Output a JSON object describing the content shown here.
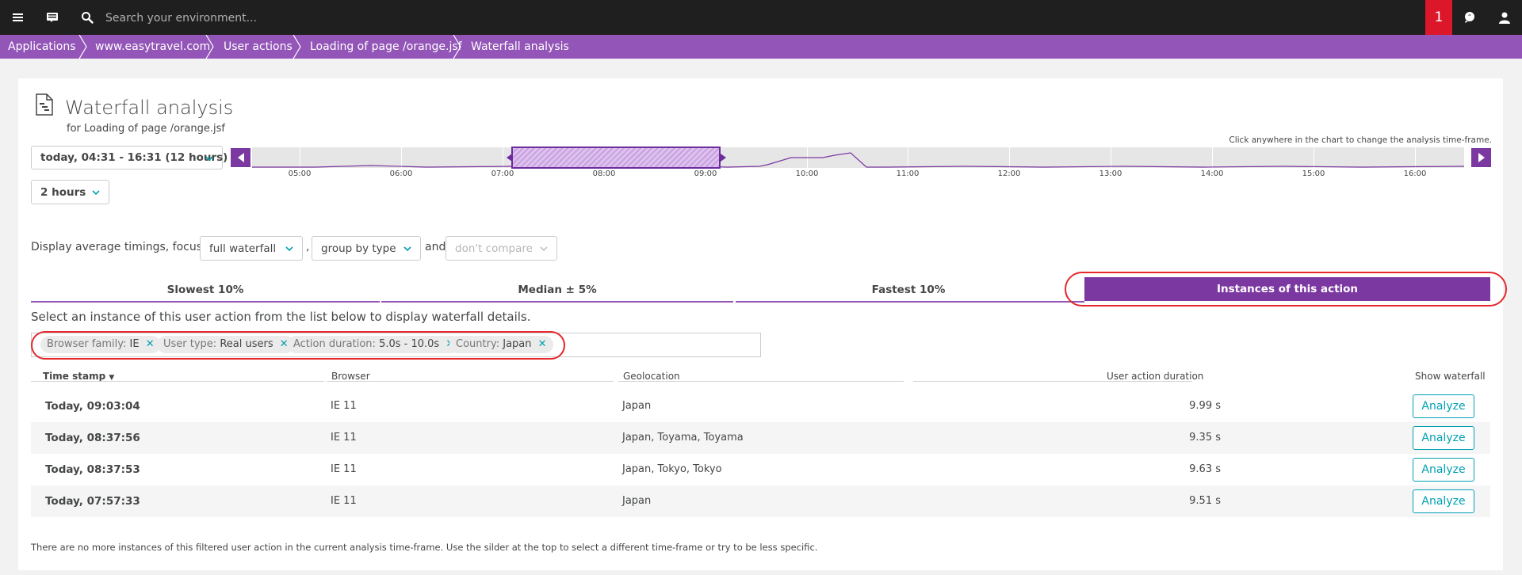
{
  "topbar": {
    "search_placeholder": "Search your environment...",
    "notification_count": "1"
  },
  "breadcrumb": [
    {
      "label": "Applications"
    },
    {
      "label": "www.easytravel.com"
    },
    {
      "label": "User actions"
    },
    {
      "label": "Loading of page /orange.jsf"
    },
    {
      "label": "Waterfall analysis"
    }
  ],
  "page": {
    "title": "Waterfall analysis",
    "subtitle": "for Loading of page /orange.jsf",
    "hint": "Click anywhere in the chart to change the analysis time-frame."
  },
  "timeframe": {
    "range_label": "today, 04:31 - 16:31 (12 hours)",
    "window_label": "2 hours",
    "ticks": [
      "05:00",
      "06:00",
      "07:00",
      "08:00",
      "09:00",
      "10:00",
      "11:00",
      "12:00",
      "13:00",
      "14:00",
      "15:00",
      "16:00"
    ]
  },
  "display": {
    "label": "Display average timings, focus on",
    "focus": "full waterfall",
    "comma": ",",
    "group": "group by type",
    "and": "and",
    "compare": "don't compare"
  },
  "tabs": [
    {
      "label": "Slowest 10%"
    },
    {
      "label": "Median ± 5%"
    },
    {
      "label": "Fastest 10%"
    },
    {
      "label": "Instances of this action",
      "active": true
    }
  ],
  "instructions": "Select an instance of this user action from the list below to display waterfall details.",
  "filters": [
    {
      "key": "Browser family:",
      "value": "IE"
    },
    {
      "key": "User type:",
      "value": "Real users"
    },
    {
      "key": "Action duration:",
      "value": "5.0s - 10.0s"
    },
    {
      "key": "Country:",
      "value": "Japan"
    }
  ],
  "table": {
    "headers": {
      "timestamp": "Time stamp",
      "sort_arrow": "▼",
      "browser": "Browser",
      "geolocation": "Geolocation",
      "duration": "User action duration",
      "waterfall": "Show waterfall"
    },
    "rows": [
      {
        "timestamp": "Today, 09:03:04",
        "browser": "IE 11",
        "geo": "Japan",
        "duration": "9.99 s",
        "action": "Analyze"
      },
      {
        "timestamp": "Today, 08:37:56",
        "browser": "IE 11",
        "geo": "Japan, Toyama, Toyama",
        "duration": "9.35 s",
        "action": "Analyze"
      },
      {
        "timestamp": "Today, 08:37:53",
        "browser": "IE 11",
        "geo": "Japan, Tokyo, Tokyo",
        "duration": "9.63 s",
        "action": "Analyze"
      },
      {
        "timestamp": "Today, 07:57:33",
        "browser": "IE 11",
        "geo": "Japan",
        "duration": "9.51 s",
        "action": "Analyze"
      }
    ]
  },
  "footnote": "There are no more instances of this filtered user action in the current analysis time-frame. Use the silder at the top to select a different time-frame or try to be less specific.",
  "colors": {
    "brand_purple": "#7c38a1",
    "breadcrumb_purple": "#9355b7",
    "accent_teal": "#00a1b2",
    "alert_red": "#dc172a",
    "annotation_red": "#e5262b"
  }
}
